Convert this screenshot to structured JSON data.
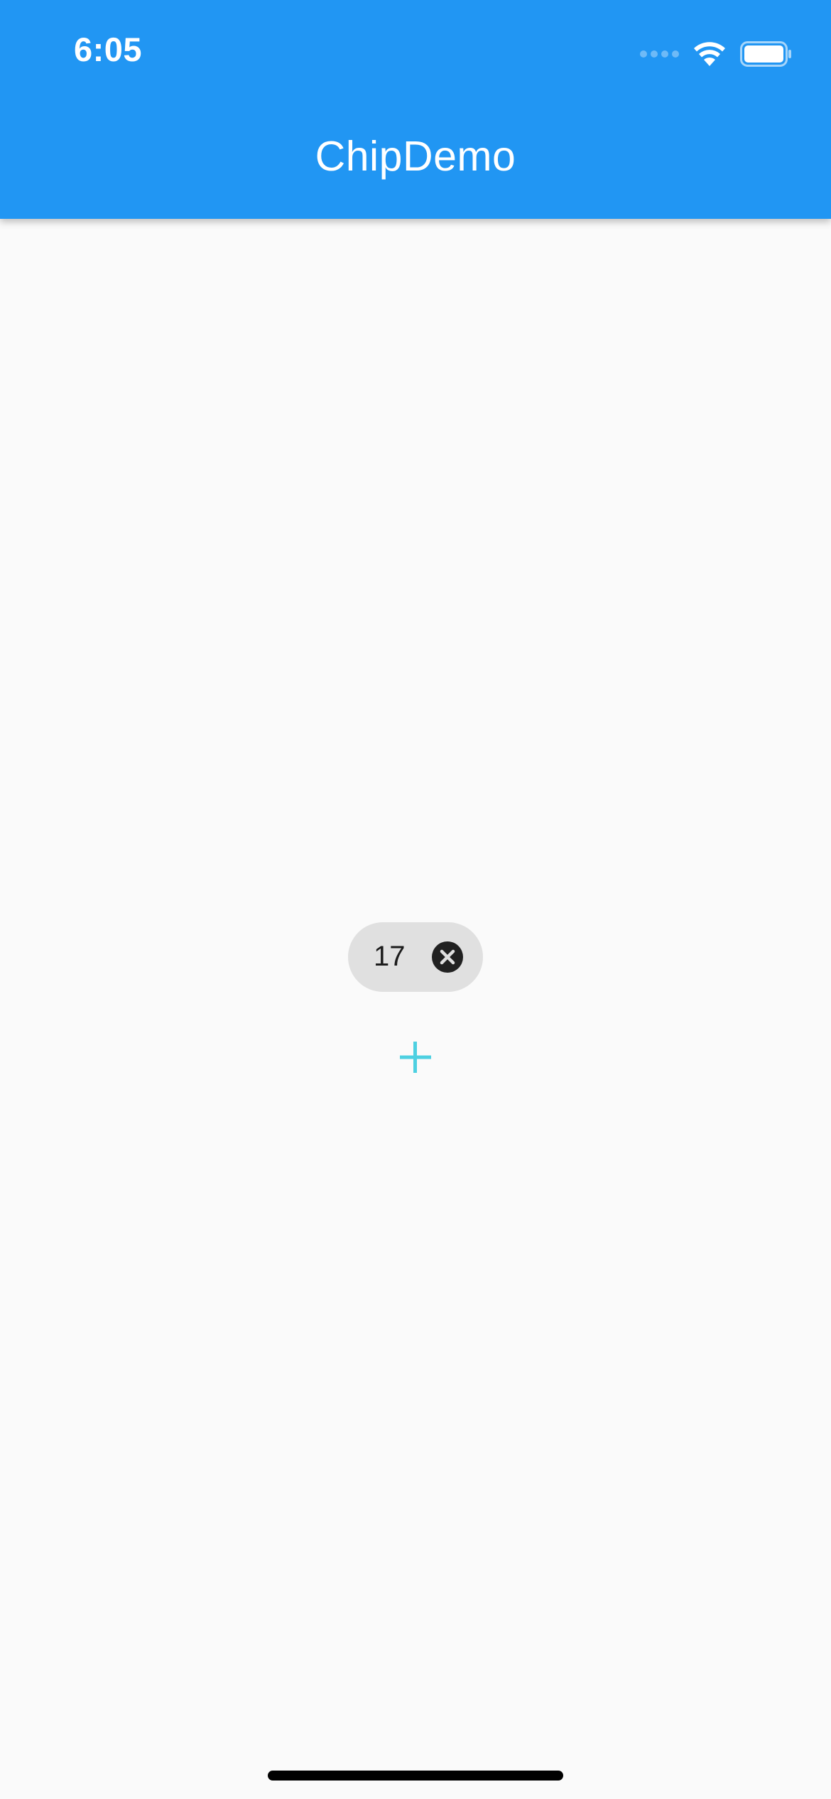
{
  "status_bar": {
    "time": "6:05",
    "signal_icon": "cellular-dots-icon",
    "wifi_icon": "wifi-icon",
    "battery_icon": "battery-icon"
  },
  "app_bar": {
    "title": "ChipDemo",
    "background_color": "#2196f3"
  },
  "main": {
    "chip": {
      "label": "17",
      "delete_icon": "cancel-circle-icon",
      "background_color": "#e0e0e0"
    },
    "add_button": {
      "icon": "plus-icon",
      "color": "#4dd0e1"
    }
  },
  "colors": {
    "accent": "#2196f3",
    "background": "#fafafa"
  }
}
